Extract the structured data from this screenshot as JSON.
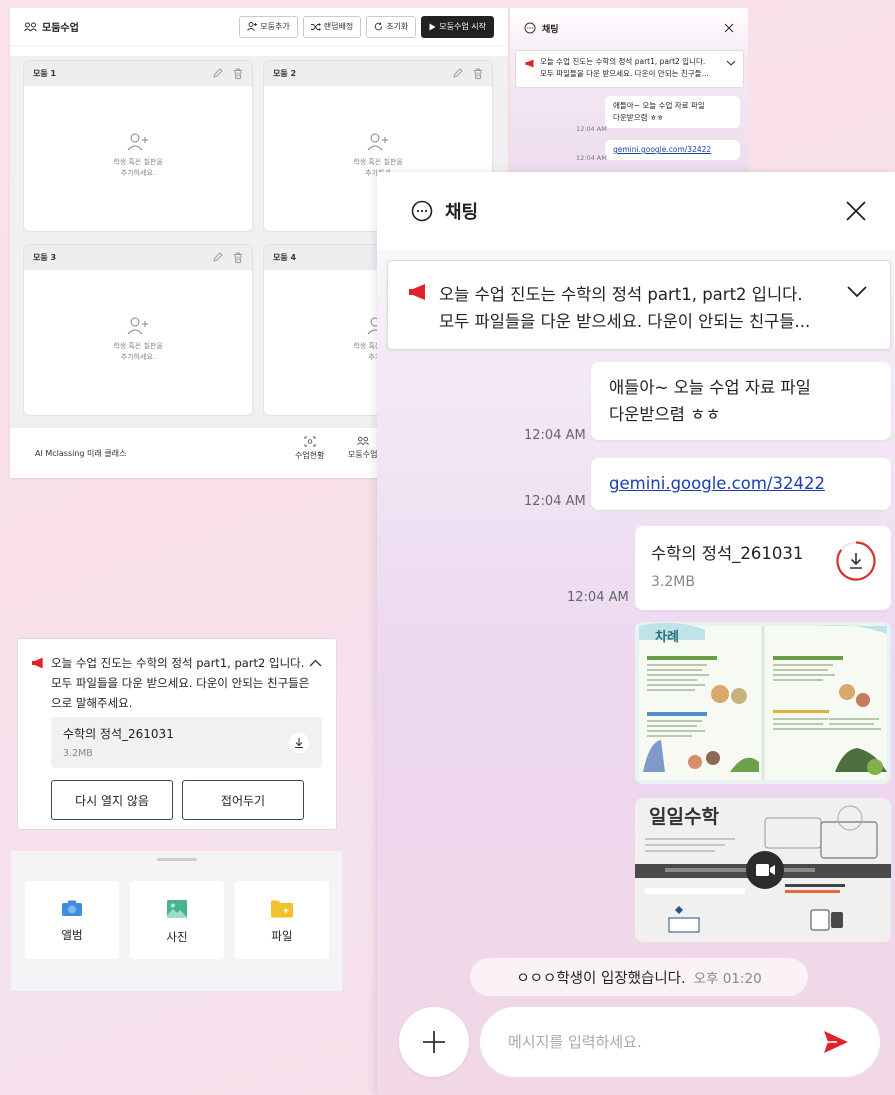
{
  "group_panel": {
    "title": "모둠수업",
    "buttons": {
      "add_group": "모둠추가",
      "random": "랜덤배정",
      "reset": "초기화",
      "start": "모둠수업 시작"
    },
    "groups": [
      {
        "name": "모둠 1",
        "empty_line1": "학생 혹은 칠판을",
        "empty_line2": "추가하세요."
      },
      {
        "name": "모둠 2",
        "empty_line1": "학생 혹은 칠판을",
        "empty_line2": "추가하세"
      },
      {
        "name": "모둠 3",
        "empty_line1": "학생 혹은 칠판을",
        "empty_line2": "추가하세요."
      },
      {
        "name": "모둠 4",
        "empty_line1": "학생 혹은 칠판을",
        "empty_line2": "추가하"
      }
    ],
    "footer": {
      "brand": "AI Mclassing 미래 클래스",
      "status": "수업현황",
      "group": "모둠수업"
    }
  },
  "small_chat": {
    "title": "채팅",
    "notice_line1": "오늘 수업 진도는 수학의 정석 part1, part2 입니다.",
    "notice_line2": "모두 파일들을 다운 받으세요. 다운이 안되는 친구들...",
    "msg1_line1": "애들아~ 오늘 수업 자료 파일",
    "msg1_line2": "다운받으렴 ㅎㅎ",
    "msg1_time": "12:04 AM",
    "msg2_link": "gemini.google.com/32422",
    "msg2_time": "12:04 AM"
  },
  "notice_panel": {
    "text": "오늘 수업 진도는 수학의 정석 part1, part2 입니다. 모두 파일들을 다운 받으세요. 다운이 안되는 친구들은 으로 말해주세요.",
    "file_name": "수학의 정석_261031",
    "file_size": "3.2MB",
    "btn_dont_open": "다시 열지 않음",
    "btn_collapse": "접어두기"
  },
  "attach_sheet": {
    "album": "앨범",
    "photo": "사진",
    "file": "파일",
    "colors": {
      "album": "#3f8ddf",
      "photo": "#49b38c",
      "file": "#f2c12e"
    }
  },
  "chat": {
    "title": "채팅",
    "notice_line1": "오늘 수업 진도는 수학의 정석 part1, part2 입니다.",
    "notice_line2": "모두 파일들을 다운 받으세요. 다운이 안되는 친구들...",
    "messages": [
      {
        "line1": "애들아~ 오늘 수업 자료 파일",
        "line2": "다운받으렴 ㅎㅎ",
        "time": "12:04 AM"
      },
      {
        "link": "gemini.google.com/32422",
        "time": "12:04 AM"
      },
      {
        "file_name": "수학의 정석_261031",
        "file_size": "3.2MB",
        "time": "12:04 AM"
      }
    ],
    "image_card_1": {
      "heading": "차례"
    },
    "image_card_2": {
      "title": "일일수학"
    },
    "join_notice": "ㅇㅇㅇ학생이 입장했습니다.",
    "join_time": "오후 01:20",
    "input_placeholder": "메시지를 입력하세요.",
    "colors": {
      "notice_icon": "#e0222d",
      "send": "#e0222d",
      "download_ring": "#d8312b"
    }
  }
}
